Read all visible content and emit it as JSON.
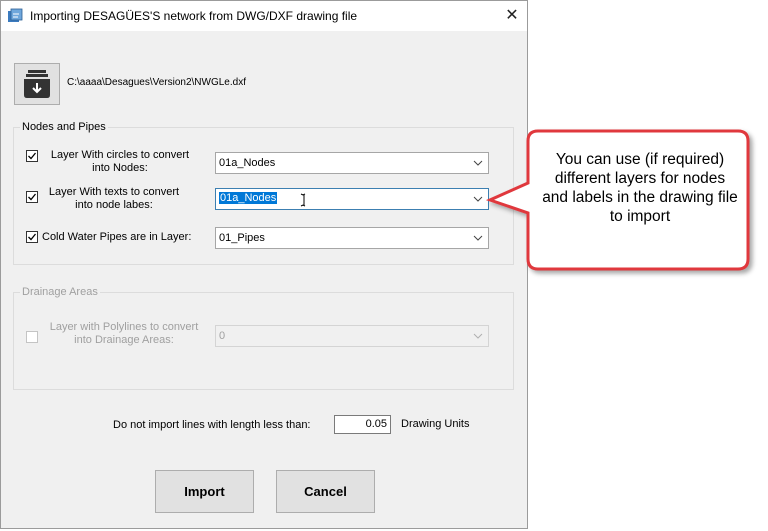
{
  "window": {
    "title": "Importing DESAGÜES'S network from DWG/DXF drawing file",
    "close_glyph": "✕"
  },
  "file": {
    "path": "C:\\aaaa\\Desagues\\Version2\\NWGLe.dxf",
    "button_icon": "open-file-icon"
  },
  "nodes_and_pipes": {
    "legend": "Nodes and Pipes",
    "rows": [
      {
        "label_line1": "Layer With circles to convert",
        "label_line2": "into Nodes:",
        "checked": true,
        "value": "01a_Nodes"
      },
      {
        "label_line1": "Layer With texts to convert",
        "label_line2": "into node labes:",
        "checked": true,
        "value": "01a_Nodes"
      },
      {
        "label": "Cold Water Pipes are in Layer:",
        "checked": true,
        "value": "01_Pipes"
      }
    ]
  },
  "drainage_areas": {
    "legend": "Drainage Areas",
    "label_line1": "Layer with Polylines to convert",
    "label_line2": "into Drainage Areas:",
    "checked": false,
    "value": "0"
  },
  "min_length": {
    "label": "Do not import lines with length less than:",
    "value": "0.05",
    "units": "Drawing Units"
  },
  "buttons": {
    "import": "Import",
    "cancel": "Cancel"
  },
  "callout": {
    "text": "You can use (if required) different layers for nodes and labels in the drawing file to import",
    "border_color": "#e0393e"
  }
}
